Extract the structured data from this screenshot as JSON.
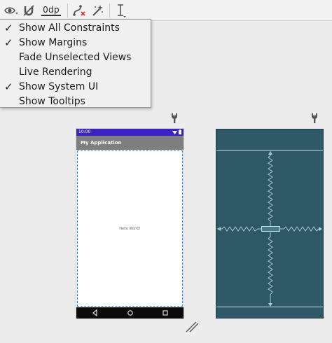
{
  "toolbar": {
    "default_margin": "0dp",
    "icons": [
      "eye-icon",
      "magnet-icon",
      "clear-constraints-icon",
      "infer-constraints-icon",
      "guidelines-icon"
    ]
  },
  "view_options_menu": {
    "items": [
      {
        "label": "Show All Constraints",
        "checked": true
      },
      {
        "label": "Show Margins",
        "checked": true
      },
      {
        "label": "Fade Unselected Views",
        "checked": false
      },
      {
        "label": "Live Rendering",
        "checked": false
      },
      {
        "label": "Show System UI",
        "checked": true
      },
      {
        "label": "Show Tooltips",
        "checked": false
      }
    ],
    "check_mark": "✓"
  },
  "design_preview": {
    "status_time": "10:00",
    "app_title": "My Application",
    "text_view": "Hello World!"
  },
  "colors": {
    "status_bar": "#3a22c4",
    "app_bar": "#7e7e7e",
    "blueprint_bg": "#2f5867",
    "selection": "#3f7bd6"
  }
}
